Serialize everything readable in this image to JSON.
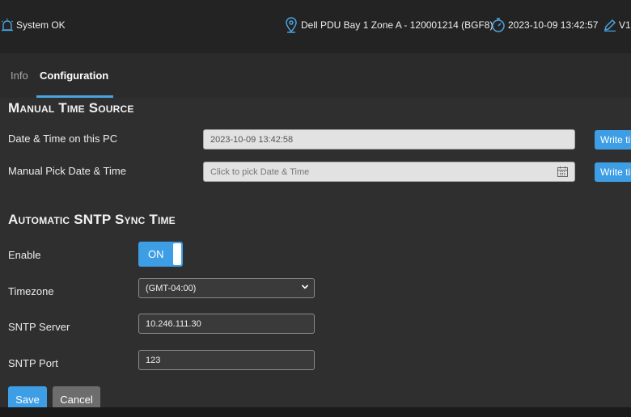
{
  "header": {
    "status_text": "System OK",
    "status_icon": "alarm-light-icon",
    "location_text": "Dell PDU Bay 1 Zone A - 120001214 (BGF8)",
    "location_icon": "location-pin-icon",
    "datetime_text": "2023-10-09 13:42:57",
    "datetime_icon": "stopwatch-icon",
    "version_text": "V1.",
    "version_icon": "pencil-icon",
    "accent_color": "#4aa3df"
  },
  "tabs": [
    {
      "label": "Info",
      "active": false
    },
    {
      "label": "Configuration",
      "active": true
    }
  ],
  "manual": {
    "title": "Manual Time Source",
    "pc_time_label": "Date & Time on this PC",
    "pc_time_value": "2023-10-09 13:42:58",
    "pick_label": "Manual Pick Date & Time",
    "pick_placeholder": "Click to pick Date & Time",
    "calendar_icon": "calendar-icon",
    "write_button_label": "Write ti"
  },
  "sntp": {
    "title": "Automatic SNTP Sync Time",
    "enable_label": "Enable",
    "enable_toggle_text": "ON",
    "timezone_label": "Timezone",
    "timezone_value": "(GMT-04:00)",
    "server_label": "SNTP Server",
    "server_value": "10.246.111.30",
    "port_label": "SNTP Port",
    "port_value": "123"
  },
  "actions": {
    "save_label": "Save",
    "cancel_label": "Cancel"
  }
}
